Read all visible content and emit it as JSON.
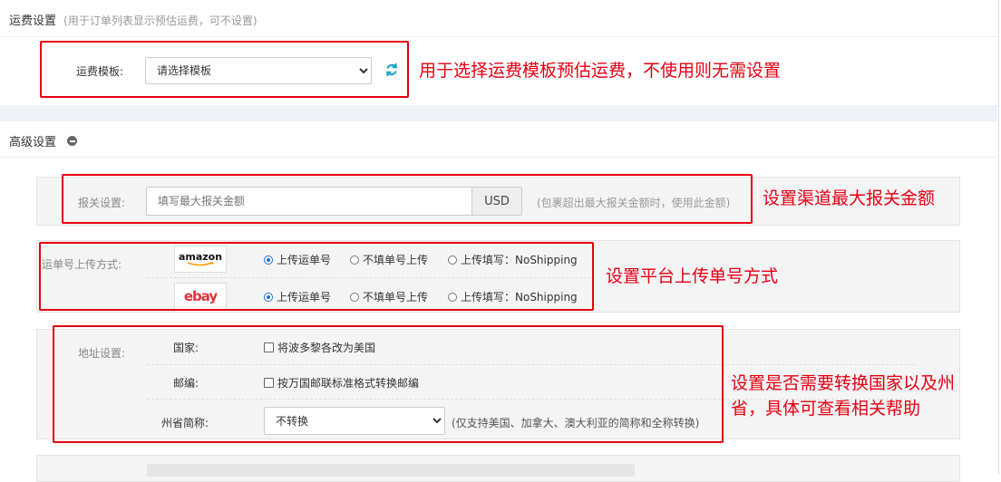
{
  "shipping": {
    "title": "运费设置",
    "hint": "(用于订单列表显示预估运费，可不设置)",
    "template_label": "运费模板:",
    "template_value": "请选择模板",
    "annotation": "用于选择运费模板预估运费，不使用则无需设置"
  },
  "advanced": {
    "title": "高级设置"
  },
  "customs": {
    "label": "报关设置:",
    "placeholder": "填写最大报关金额",
    "currency": "USD",
    "hint": "(包裹超出最大报关金额时，使用此金额)",
    "annotation": "设置渠道最大报关金额"
  },
  "tracking": {
    "label": "运单号上传方式:",
    "annotation": "设置平台上传单号方式",
    "platforms": [
      {
        "name": "amazon",
        "options": [
          "上传运单号",
          "不填单号上传",
          "上传填写：NoShipping"
        ],
        "selected": 0
      },
      {
        "name": "ebay",
        "options": [
          "上传运单号",
          "不填单号上传",
          "上传填写：NoShipping"
        ],
        "selected": 0
      }
    ]
  },
  "address": {
    "label": "地址设置:",
    "country_label": "国家:",
    "country_option": "将波多黎各改为美国",
    "zip_label": "邮编:",
    "zip_option": "按万国邮联标准格式转换邮编",
    "state_label": "州省简称:",
    "state_value": "不转换",
    "state_hint": "(仅支持美国、加拿大、澳大利亚的简称和全称转换)",
    "annotation_line1": "设置是否需要转换国家以及州",
    "annotation_line2": "省，具体可查看相关帮助"
  },
  "colors": {
    "annotation_red": "#e60012",
    "accent_blue": "#1e6fd9"
  }
}
